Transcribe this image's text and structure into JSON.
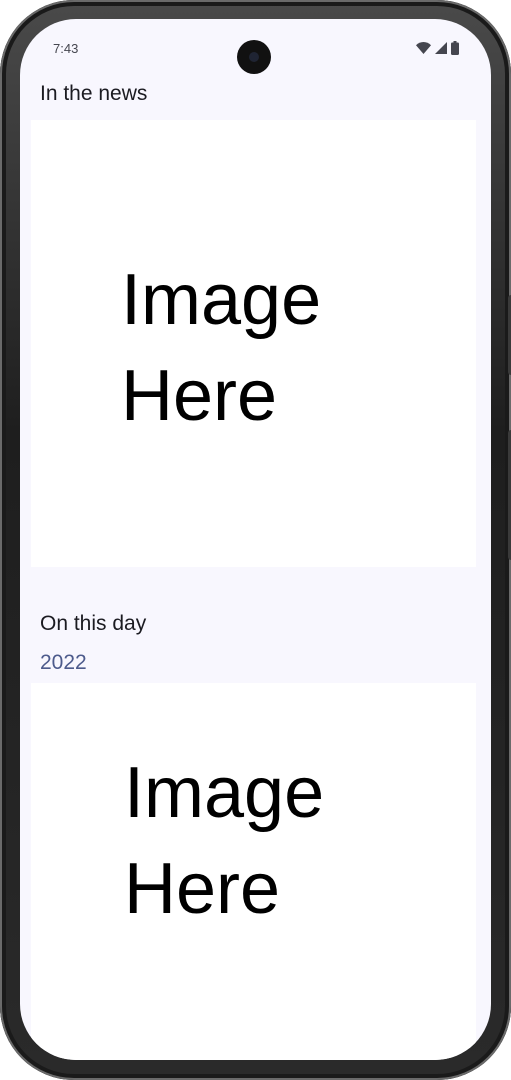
{
  "status_bar": {
    "time": "7:43",
    "icons": [
      "wifi-icon",
      "signal-icon",
      "battery-icon"
    ]
  },
  "news": {
    "title": "In the news",
    "image_placeholder": "Image\nHere"
  },
  "on_this_day": {
    "title": "On this day",
    "year": "2022",
    "image_placeholder": "Image\nHere"
  },
  "colors": {
    "background": "#f8f7fe",
    "year_accent": "#4d5b8c",
    "card": "#ffffff"
  }
}
